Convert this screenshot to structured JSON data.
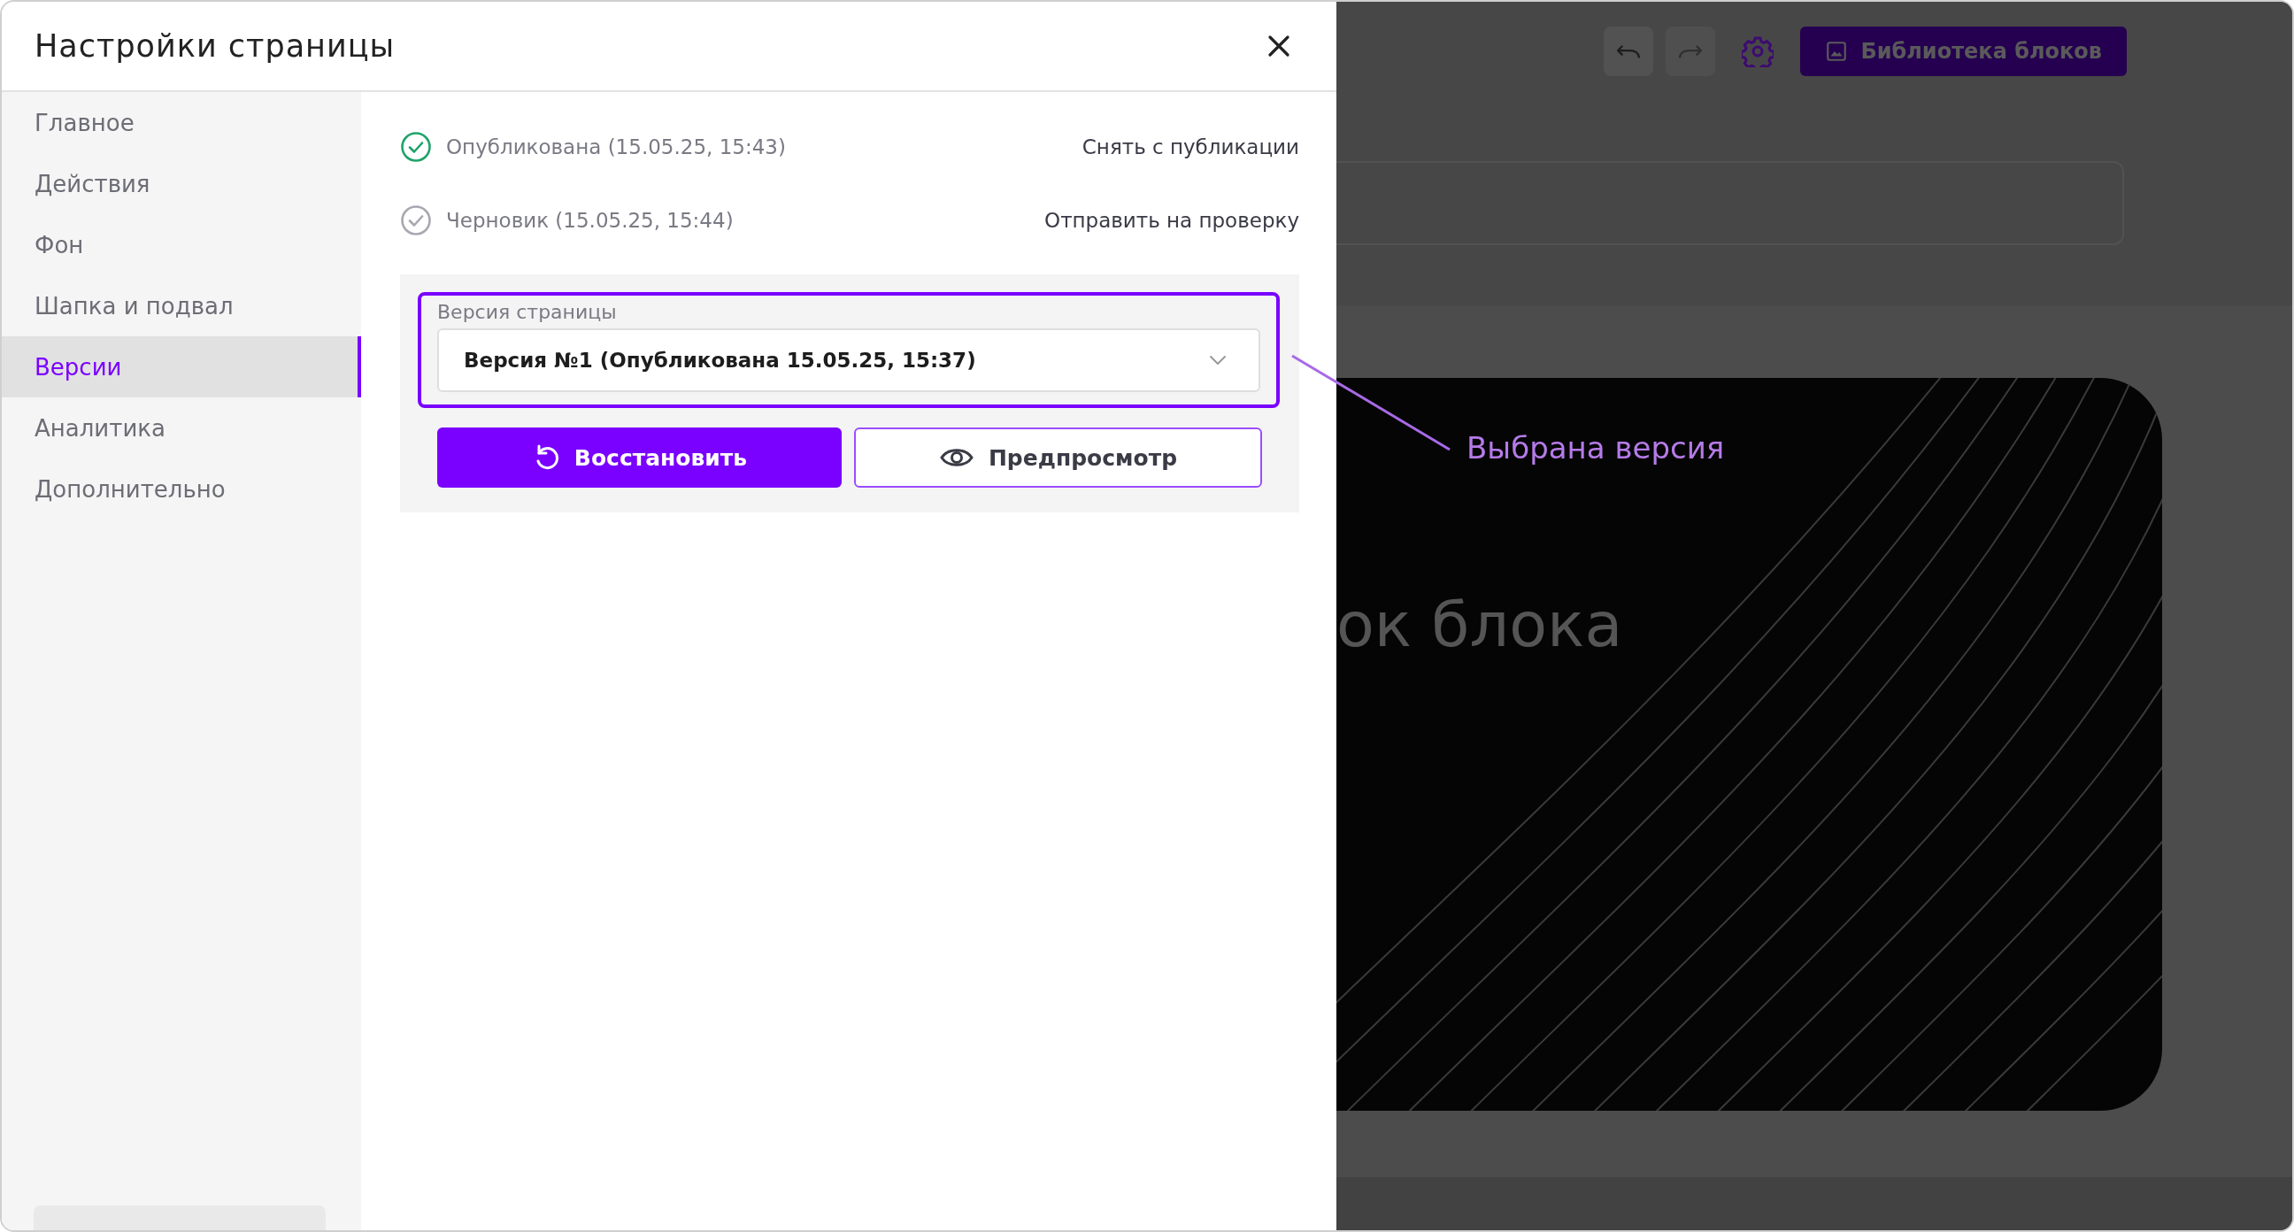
{
  "dialog": {
    "title": "Настройки страницы"
  },
  "sidebar": {
    "items": [
      {
        "label": "Главное",
        "selected": false
      },
      {
        "label": "Действия",
        "selected": false
      },
      {
        "label": "Фон",
        "selected": false
      },
      {
        "label": "Шапка и подвал",
        "selected": false
      },
      {
        "label": "Версии",
        "selected": true
      },
      {
        "label": "Аналитика",
        "selected": false
      },
      {
        "label": "Дополнительно",
        "selected": false
      }
    ]
  },
  "statuses": [
    {
      "kind": "published",
      "text": "Опубликована (15.05.25, 15:43)",
      "action": "Снять с публикации"
    },
    {
      "kind": "draft",
      "text": "Черновик (15.05.25, 15:44)",
      "action": "Отправить на проверку"
    }
  ],
  "version_select": {
    "label": "Версия страницы",
    "value": "Версия №1 (Опубликована 15.05.25, 15:37)",
    "highlighted": true
  },
  "buttons": [
    {
      "kind": "primary",
      "label": "Восстановить"
    },
    {
      "kind": "secondary",
      "label": "Предпросмотр"
    }
  ],
  "annotation": {
    "text": "Выбрана версия"
  },
  "editor": {
    "history": [
      {
        "kind": "undo",
        "disabled": false
      },
      {
        "kind": "redo",
        "disabled": true
      }
    ],
    "library_button": "Библиотека блоков",
    "block_title": "ок блока"
  }
}
